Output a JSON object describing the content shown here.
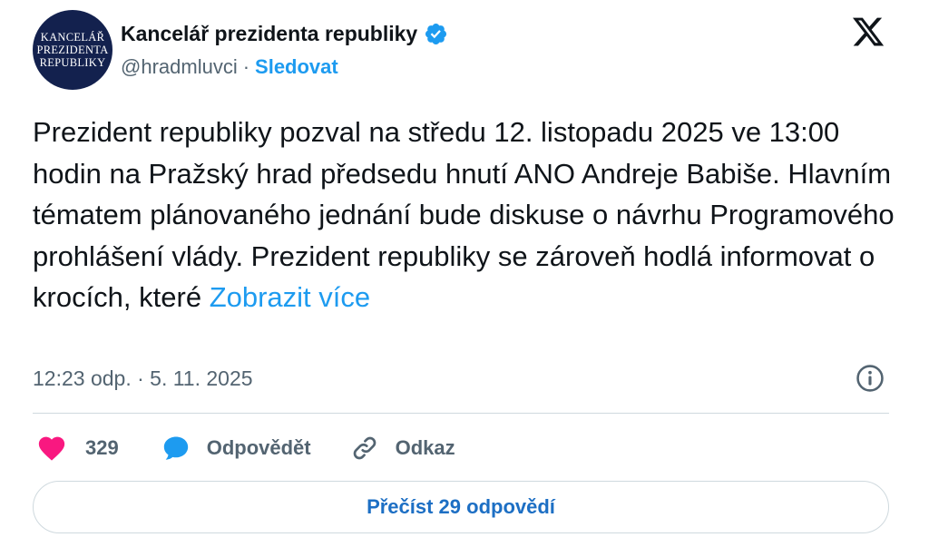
{
  "author": {
    "avatar_lines": [
      "KANCELÁŘ",
      "PREZIDENTA",
      "REPUBLIKY"
    ],
    "display_name": "Kancelář prezidenta republiky",
    "verified_icon": "verified-badge-icon",
    "handle": "@hradmluvci",
    "separator": "·",
    "follow_label": "Sledovat"
  },
  "platform_icon": "x-logo-icon",
  "tweet": {
    "text": "Prezident republiky pozval na středu 12. listopadu 2025 ve 13:00 hodin na Pražský hrad předsedu hnutí ANO Andreje Babiše. Hlavním tématem plánovaného jednání bude diskuse o návrhu Programového prohlášení vlády. Prezident republiky se zároveň hodlá informovat o krocích, které",
    "show_more_label": "Zobrazit více"
  },
  "meta": {
    "timestamp": "12:23 odp. · 5. 11. 2025",
    "info_icon": "info-icon"
  },
  "actions": {
    "like_count": "329",
    "reply_label": "Odpovědět",
    "link_label": "Odkaz"
  },
  "read_replies_label": "Přečíst 29 odpovědí",
  "colors": {
    "accent": "#1d9bf0",
    "like": "#f91880",
    "muted": "#536471",
    "avatar_bg": "#13214e"
  }
}
